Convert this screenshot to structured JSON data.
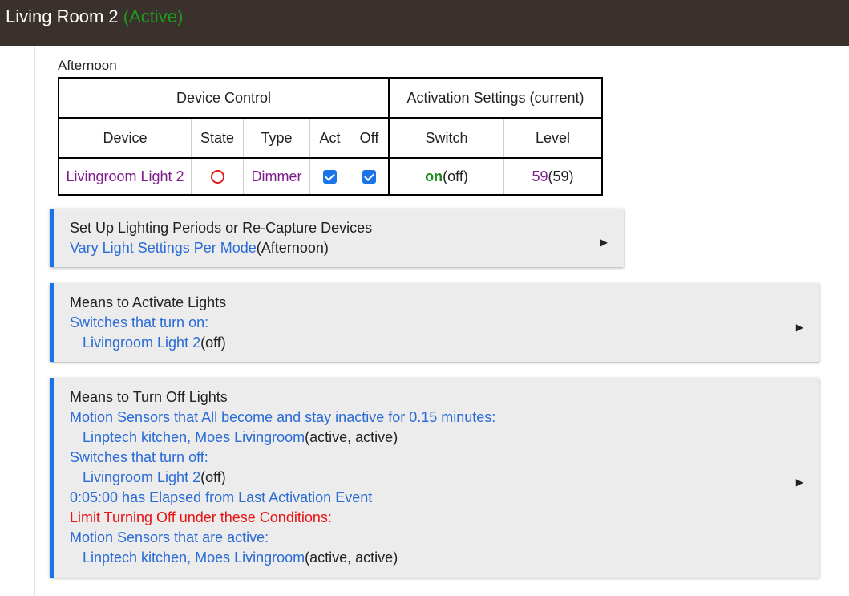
{
  "header": {
    "title": "Living Room 2",
    "status": "(Active)"
  },
  "period": "Afternoon",
  "table": {
    "group_left": "Device Control",
    "group_right": "Activation Settings (current)",
    "columns": [
      "Device",
      "State",
      "Type",
      "Act",
      "Off",
      "Switch",
      "Level"
    ],
    "row": {
      "device": "Livingroom Light 2",
      "type": "Dimmer",
      "switch_value": "on",
      "switch_current": "(off)",
      "level_value": "59",
      "level_current": "(59)"
    }
  },
  "card1": {
    "title": "Set Up Lighting Periods or Re-Capture Devices",
    "link": "Vary Light Settings Per Mode",
    "suffix": "(Afternoon)"
  },
  "card2": {
    "title": "Means to Activate Lights",
    "l1": "Switches that turn on:",
    "l2_link": "Livingroom Light 2",
    "l2_suffix": "(off)"
  },
  "card3": {
    "title": "Means to Turn Off Lights",
    "l1": "Motion Sensors that All become and stay inactive for 0.15 minutes:",
    "l2_link": "Linptech kitchen, Moes Livingroom",
    "l2_suffix": "(active, active)",
    "l3": "Switches that turn off:",
    "l4_link": "Livingroom Light 2",
    "l4_suffix": "(off)",
    "l5": "0:05:00 has Elapsed from Last Activation Event",
    "l6": "Limit Turning Off under these Conditions:",
    "l7": "Motion Sensors that are active:",
    "l8_link": "Linptech kitchen, Moes Livingroom",
    "l8_suffix": "(active, active)"
  },
  "arrow_glyph": "▶"
}
